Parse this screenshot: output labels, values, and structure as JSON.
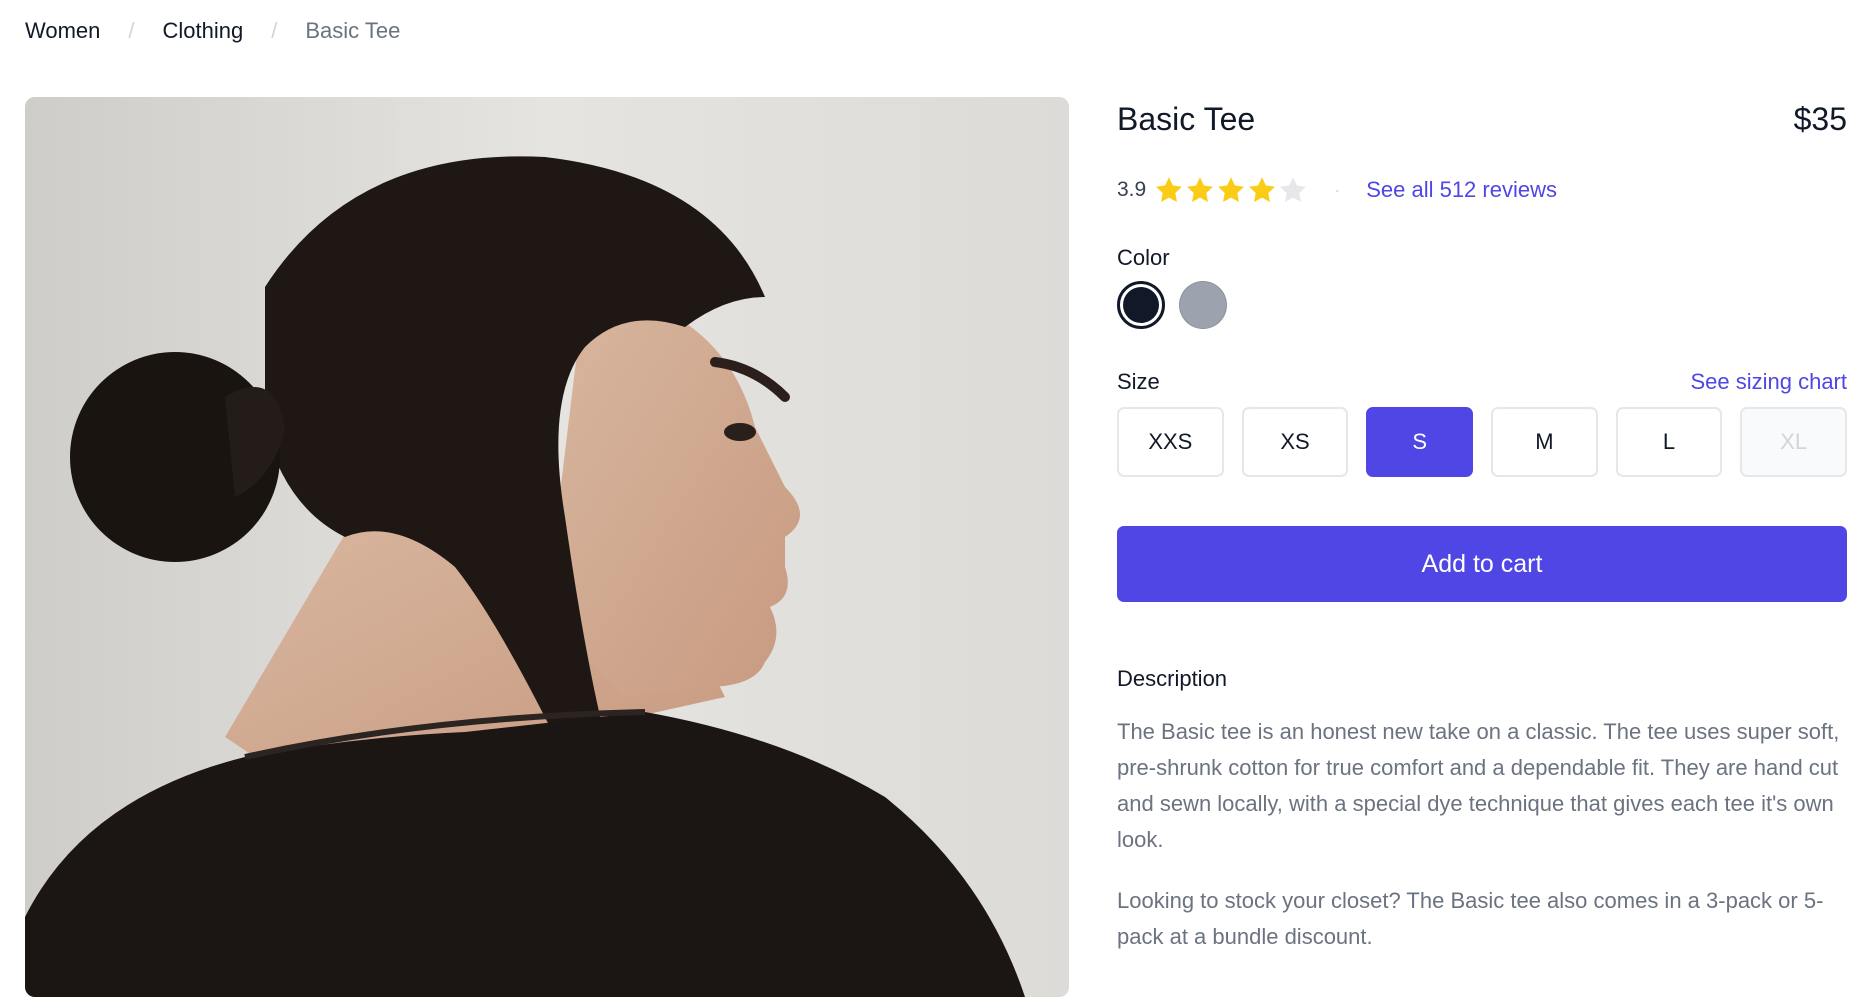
{
  "breadcrumb": {
    "items": [
      "Women",
      "Clothing"
    ],
    "current": "Basic Tee",
    "separator": "/"
  },
  "product": {
    "image_alt": "Model wearing black tee, side profile",
    "title": "Basic Tee",
    "price": "$35",
    "rating": {
      "value": "3.9",
      "stars_filled": 4,
      "stars_total": 5,
      "reviews_link": "See all 512 reviews",
      "dot": "·"
    },
    "colors": {
      "label": "Color",
      "options": [
        {
          "name": "Black",
          "hex": "#111827",
          "selected": true
        },
        {
          "name": "Heather Grey",
          "hex": "#9ca3af",
          "selected": false
        }
      ]
    },
    "sizes": {
      "label": "Size",
      "chart_link": "See sizing chart",
      "options": [
        {
          "label": "XXS",
          "state": "available"
        },
        {
          "label": "XS",
          "state": "available"
        },
        {
          "label": "S",
          "state": "selected"
        },
        {
          "label": "M",
          "state": "available"
        },
        {
          "label": "L",
          "state": "available"
        },
        {
          "label": "XL",
          "state": "disabled"
        }
      ]
    },
    "add_to_cart": "Add to cart",
    "description": {
      "label": "Description",
      "paragraphs": [
        "The Basic tee is an honest new take on a classic. The tee uses super soft, pre-shrunk cotton for true comfort and a dependable fit. They are hand cut and sewn locally, with a special dye technique that gives each tee it's own look.",
        "Looking to stock your closet? The Basic tee also comes in a 3-pack or 5-pack at a bundle discount."
      ]
    }
  },
  "colors": {
    "accent": "#4f46e5",
    "star": "#facc15",
    "star_empty": "#e5e7eb"
  }
}
